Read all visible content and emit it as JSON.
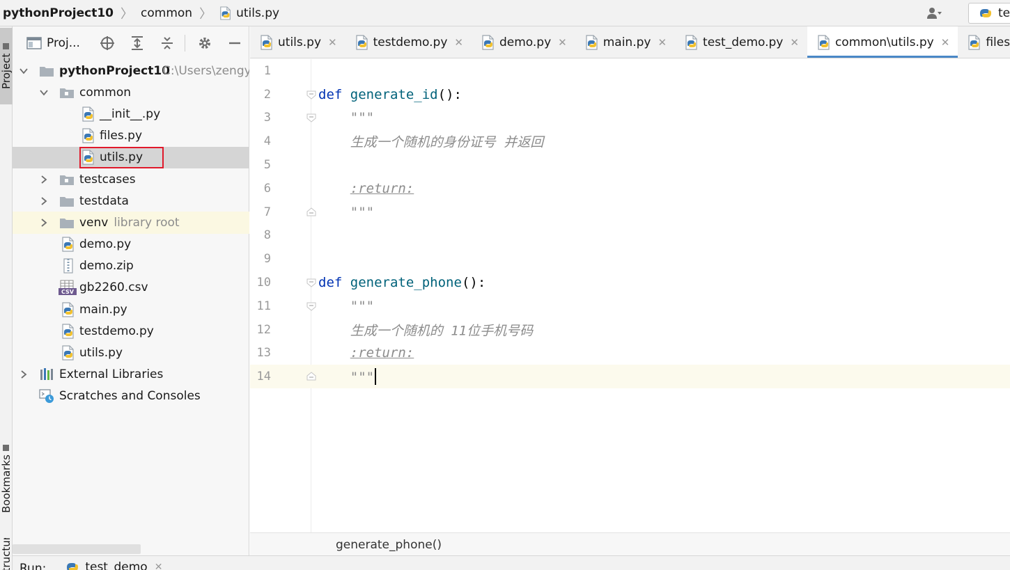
{
  "navbar": {
    "project": "pythonProject10",
    "folder": "common",
    "file": "utils.py",
    "run_config_text": "te"
  },
  "left_strip": {
    "project_tab": "Project",
    "bookmarks_tab": "Bookmarks",
    "structure_tab": "Structure"
  },
  "project_panel": {
    "title": "Proj...",
    "tree": {
      "root_name": "pythonProject10",
      "root_path": "C:\\Users\\zengy",
      "common": "common",
      "init": "__init__.py",
      "files": "files.py",
      "utils_common": "utils.py",
      "testcases": "testcases",
      "testdata": "testdata",
      "venv": "venv",
      "venv_hint": "library root",
      "demo_py": "demo.py",
      "demo_zip": "demo.zip",
      "gb2260": "gb2260.csv",
      "main_py": "main.py",
      "testdemo_py": "testdemo.py",
      "utils_root": "utils.py",
      "external_libraries": "External Libraries",
      "scratches": "Scratches and Consoles"
    }
  },
  "tabs": [
    {
      "label": "utils.py"
    },
    {
      "label": "testdemo.py"
    },
    {
      "label": "demo.py"
    },
    {
      "label": "main.py"
    },
    {
      "label": "test_demo.py"
    },
    {
      "label": "common\\utils.py"
    },
    {
      "label": "files.py"
    }
  ],
  "editor": {
    "line_numbers": [
      "1",
      "2",
      "3",
      "4",
      "5",
      "6",
      "7",
      "8",
      "9",
      "10",
      "11",
      "12",
      "13",
      "14"
    ],
    "kw_def": "def",
    "fn1": "generate_id",
    "fn2": "generate_phone",
    "signature_suffix": "():",
    "docstring_quotes": "\"\"\"",
    "doc1": "生成一个随机的身份证号 并返回",
    "doc2": "生成一个随机的 11位手机号码",
    "return_tag": ":return:"
  },
  "editor_breadcrumb": "generate_phone()",
  "run_bar": {
    "label": "Run:",
    "tab": "test_demo"
  },
  "colors": {
    "accent": "#4a88c7",
    "selection_box": "#e0192b",
    "keyword": "#0033b3",
    "function": "#00627a",
    "docstring": "#8c8c8c"
  }
}
